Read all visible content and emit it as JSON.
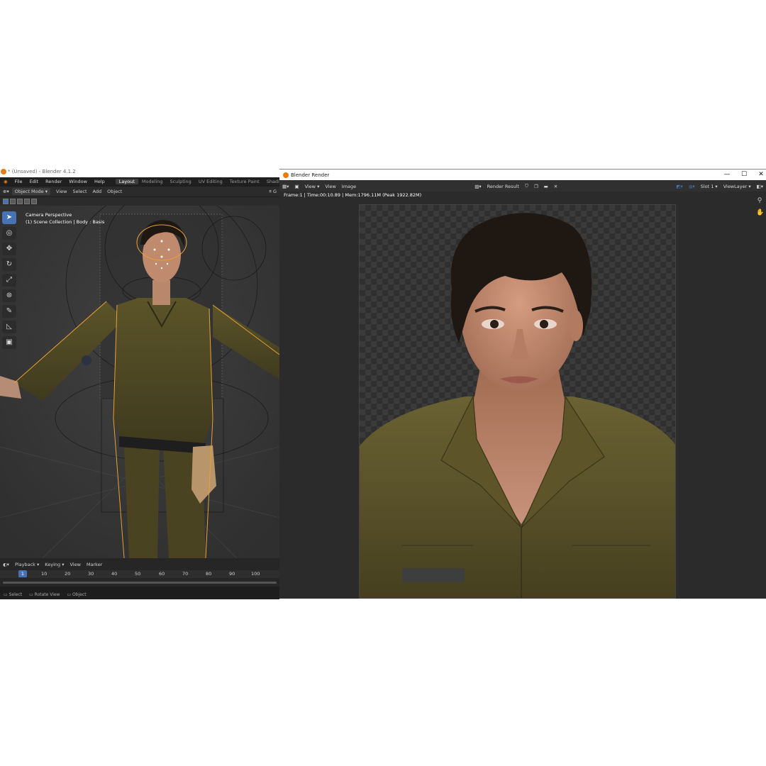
{
  "left_window": {
    "title": "* (Unsaved) - Blender 4.1.2",
    "menu": [
      "File",
      "Edit",
      "Render",
      "Window",
      "Help"
    ],
    "workspaces": [
      "Layout",
      "Modeling",
      "Sculpting",
      "UV Editing",
      "Texture Paint",
      "Shading"
    ],
    "active_workspace": "Layout",
    "header": {
      "mode": "Object Mode",
      "items": [
        "View",
        "Select",
        "Add",
        "Object"
      ]
    },
    "viewport": {
      "camera_label": "Camera Perspective",
      "collection_label": "(1) Scene Collection | Body : Basis"
    },
    "toolbar": [
      "select-box",
      "cursor",
      "move",
      "rotate",
      "scale",
      "transform",
      "annotate",
      "measure",
      "add-cube"
    ],
    "timeline": {
      "menu": [
        "Playback",
        "Keying",
        "View",
        "Marker"
      ],
      "current_frame": "1",
      "ticks": [
        "10",
        "20",
        "30",
        "40",
        "50",
        "60",
        "70",
        "80",
        "90",
        "100"
      ]
    },
    "status": [
      "Select",
      "Rotate View",
      "Object"
    ]
  },
  "right_window": {
    "title": "Blender Render",
    "header": {
      "menu1": "View",
      "menu2": "View",
      "menu3": "Image",
      "image_name": "Render Result",
      "slot": "Slot 1",
      "layer": "ViewLayer"
    },
    "info": "Frame:1 | Time:00:10.89 | Mem:1796.11M (Peak 1922.82M)"
  },
  "colors": {
    "accent": "#4772b3",
    "blender_orange": "#e87d0d",
    "uniform": "#5a5328",
    "skin": "#c08a6e",
    "hair": "#1e1712"
  }
}
